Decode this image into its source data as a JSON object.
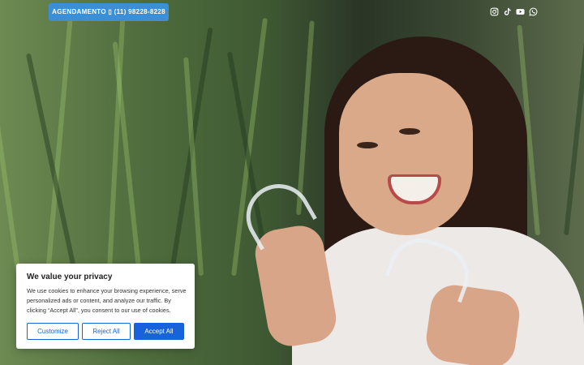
{
  "topbar": {
    "agenda_label": "AGENDAMENTO ▯ (11) 98228-8228",
    "socials": [
      {
        "icon": "instagram-icon"
      },
      {
        "icon": "tiktok-icon"
      },
      {
        "icon": "youtube-icon"
      },
      {
        "icon": "whatsapp-icon"
      }
    ]
  },
  "cookie": {
    "title": "We value your privacy",
    "text": "We use cookies to enhance your browsing experience, serve personalized ads or content, and analyze our traffic. By clicking “Accept All”, you consent to our use of cookies.",
    "customize_label": "Customize",
    "reject_label": "Reject All",
    "accept_label": "Accept All",
    "accent_color": "#1863dc"
  },
  "colors": {
    "agenda_button": "#3b8fd6"
  }
}
